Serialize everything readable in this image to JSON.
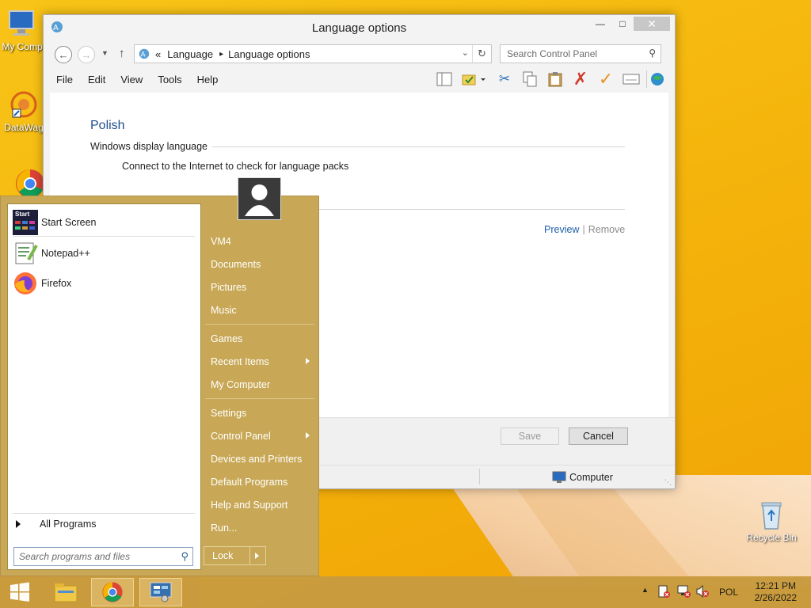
{
  "desktop": {
    "icons": [
      {
        "label": "My Comp",
        "icon": "computer-icon"
      },
      {
        "label": "DataWag",
        "icon": "datawagon-icon"
      },
      {
        "label": "",
        "icon": "chrome-icon"
      },
      {
        "label": "Recycle Bin",
        "icon": "recycle-bin-icon"
      }
    ]
  },
  "window": {
    "title": "Language options",
    "breadcrumb": [
      "«",
      "Language",
      "Language options"
    ],
    "search_placeholder": "Search Control Panel",
    "menu": [
      "File",
      "Edit",
      "View",
      "Tools",
      "Help"
    ],
    "language_title": "Polish",
    "section_heading": "Windows display language",
    "connect_text": "Connect to the Internet to check for language packs",
    "preview_link": "Preview",
    "link_sep": "|",
    "remove_link": "Remove",
    "save_label": "Save",
    "cancel_label": "Cancel",
    "status_computer": "Computer"
  },
  "start_menu": {
    "pinned": [
      {
        "label": "Start Screen",
        "icon": "start-screen-icon",
        "icon_text": "Start"
      },
      {
        "label": "Notepad++",
        "icon": "notepadpp-icon"
      },
      {
        "label": "Firefox",
        "icon": "firefox-icon"
      }
    ],
    "all_programs": "All Programs",
    "search_placeholder": "Search programs and files",
    "right_items": [
      {
        "label": "VM4",
        "submenu": false
      },
      {
        "label": "Documents",
        "submenu": false
      },
      {
        "label": "Pictures",
        "submenu": false
      },
      {
        "label": "Music",
        "submenu": false
      },
      {
        "label": "Games",
        "submenu": false
      },
      {
        "label": "Recent Items",
        "submenu": true
      },
      {
        "label": "My Computer",
        "submenu": false
      },
      {
        "label": "Settings",
        "submenu": false
      },
      {
        "label": "Control Panel",
        "submenu": true
      },
      {
        "label": "Devices and Printers",
        "submenu": false
      },
      {
        "label": "Default Programs",
        "submenu": false
      },
      {
        "label": "Help and Support",
        "submenu": false
      },
      {
        "label": "Run...",
        "submenu": false
      }
    ],
    "lock_label": "Lock"
  },
  "taskbar": {
    "language": "POL",
    "time": "12:21 PM",
    "date": "2/26/2022"
  }
}
